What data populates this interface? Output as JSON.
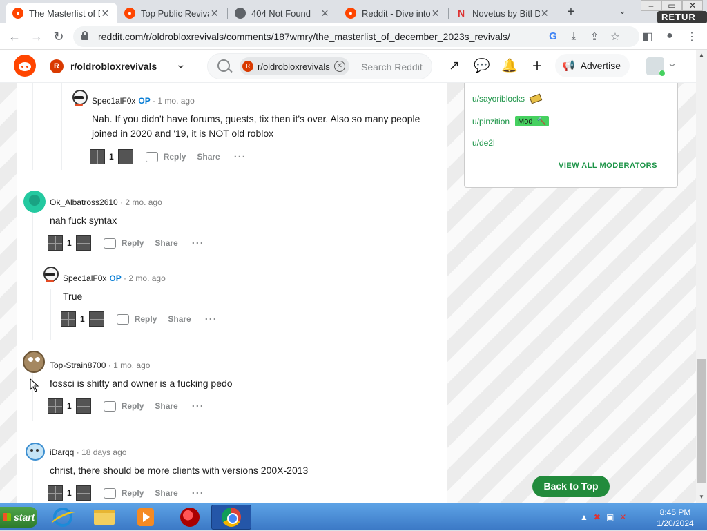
{
  "browser": {
    "tabs": [
      {
        "title": "The Masterlist of D",
        "favicon": "reddit-icon",
        "active": true
      },
      {
        "title": "Top Public Revival",
        "favicon": "reddit-icon",
        "active": false
      },
      {
        "title": "404 Not Found",
        "favicon": "globe-icon",
        "active": false
      },
      {
        "title": "Reddit - Dive into",
        "favicon": "reddit-icon",
        "active": false
      },
      {
        "title": "Novetus by Bitl D",
        "favicon": "novetus-icon",
        "active": false
      }
    ],
    "url": "reddit.com/r/oldrobloxrevivals/comments/187wmry/the_masterlist_of_december_2023s_revivals/",
    "extension_badge": "RETUR"
  },
  "reddit_header": {
    "subreddit": "r/oldrobloxrevivals",
    "search_chip": "r/oldrobloxrevivals",
    "search_placeholder": "Search Reddit",
    "advertise_label": "Advertise"
  },
  "comments": [
    {
      "author": "Spec1alF0x",
      "op": "OP",
      "time": "1 mo. ago",
      "body": "Nah. If you didn't have forums, guests, tix then it's over. Also so many people joined in 2020 and '19, it is NOT old roblox",
      "score": "1",
      "reply": "Reply",
      "share": "Share",
      "more": "···"
    },
    {
      "author": "Ok_Albatross2610",
      "op": "",
      "time": "2 mo. ago",
      "body": "nah fuck syntax",
      "score": "1",
      "reply": "Reply",
      "share": "Share",
      "more": "···"
    },
    {
      "author": "Spec1alF0x",
      "op": "OP",
      "time": "2 mo. ago",
      "body": "True",
      "score": "1",
      "reply": "Reply",
      "share": "Share",
      "more": "···"
    },
    {
      "author": "Top-Strain8700",
      "op": "",
      "time": "1 mo. ago",
      "body": "fossci is shitty and owner is a fucking pedo",
      "score": "1",
      "reply": "Reply",
      "share": "Share",
      "more": "···"
    },
    {
      "author": "iDarqq",
      "op": "",
      "time": "18 days ago",
      "body": "christ, there should be more clients with versions 200X-2013",
      "score": "1",
      "reply": "Reply",
      "share": "Share",
      "more": "···"
    }
  ],
  "sidebar": {
    "moderators": [
      {
        "name": "u/sayoriblocks",
        "flair": ""
      },
      {
        "name": "u/pinzition",
        "flair": "Mod"
      },
      {
        "name": "u/de2l",
        "flair": ""
      }
    ],
    "view_all": "VIEW ALL MODERATORS"
  },
  "back_to_top": "Back to Top",
  "taskbar": {
    "start_label": "start",
    "time": "8:45 PM",
    "date": "1/20/2024"
  }
}
